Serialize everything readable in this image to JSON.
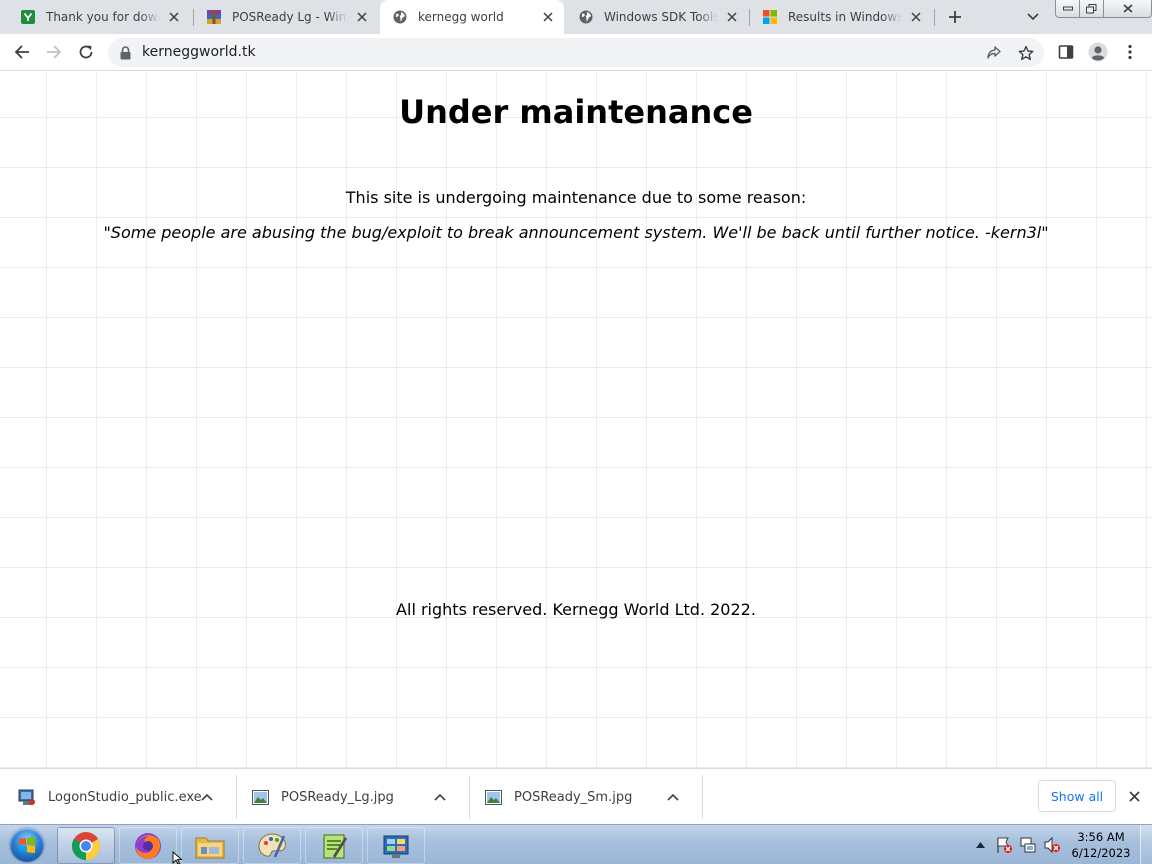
{
  "browser": {
    "tabs": [
      {
        "title": "Thank you for downloading",
        "favicon": "green-download-icon",
        "active": false
      },
      {
        "title": "POSReady Lg - Windows",
        "favicon": "winrar-icon",
        "active": false
      },
      {
        "title": "kernegg world",
        "favicon": "globe-icon",
        "active": true
      },
      {
        "title": "Windows SDK Tools List",
        "favicon": "globe-icon",
        "active": false
      },
      {
        "title": "Results in Windows - Microsoft",
        "favicon": "microsoft-logo-icon",
        "active": false
      }
    ],
    "address": "kerneggworld.tk"
  },
  "page": {
    "heading": "Under maintenance",
    "intro": "This site is undergoing maintenance due to some reason:",
    "quote": "\"Some people are abusing the bug/exploit to break announcement system. We'll be back until further notice. -kern3l\"",
    "footer": "All rights reserved. Kernegg World Ltd. 2022."
  },
  "downloads": {
    "items": [
      {
        "name": "LogonStudio_public.exe",
        "icon": "installer-icon"
      },
      {
        "name": "POSReady_Lg.jpg",
        "icon": "image-file-icon"
      },
      {
        "name": "POSReady_Sm.jpg",
        "icon": "image-file-icon"
      }
    ],
    "show_all_label": "Show all"
  },
  "taskbar": {
    "apps": [
      "chrome",
      "firefox",
      "file-explorer",
      "paint",
      "notepad-editor",
      "control-panel"
    ],
    "clock": {
      "time": "3:56 AM",
      "date": "6/12/2023"
    }
  },
  "colors": {
    "tab_strip": "#dee1e6",
    "accent_link": "#1a73e8",
    "taskbar": "#a6bfdc"
  }
}
